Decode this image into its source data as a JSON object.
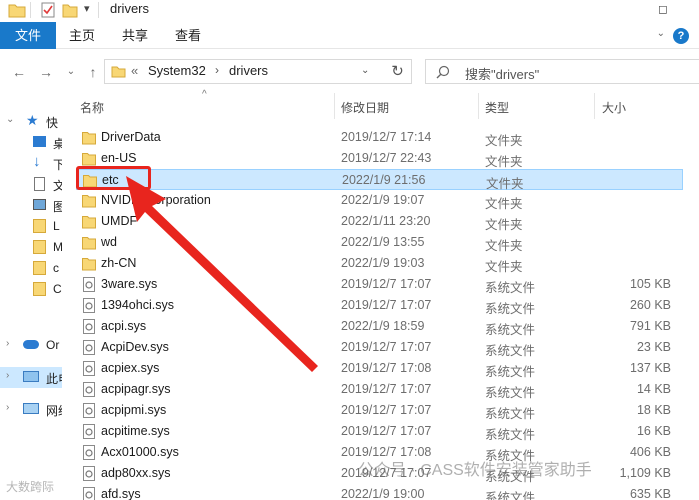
{
  "window": {
    "title": "drivers"
  },
  "ribbon": {
    "tabs": [
      "文件",
      "主页",
      "共享",
      "查看"
    ],
    "help_glyph": "?"
  },
  "address": {
    "overflow": "«",
    "segments": [
      "System32",
      "drivers"
    ]
  },
  "search": {
    "placeholder": "搜索\"drivers\""
  },
  "nav_pane": {
    "items": [
      {
        "label": "快"
      },
      {
        "label": "桌"
      },
      {
        "label": "下"
      },
      {
        "label": "文"
      },
      {
        "label": "图"
      },
      {
        "label": "L"
      },
      {
        "label": "M"
      },
      {
        "label": "c"
      },
      {
        "label": "C"
      },
      {
        "label": "Or"
      },
      {
        "label": "此电"
      },
      {
        "label": "网络"
      }
    ]
  },
  "columns": {
    "name": "名称",
    "date": "修改日期",
    "type": "类型",
    "size": "大小"
  },
  "files": [
    {
      "name": "DriverData",
      "date": "2019/12/7 17:14",
      "type": "文件夹",
      "size": "",
      "kind": "folder"
    },
    {
      "name": "en-US",
      "date": "2019/12/7 22:43",
      "type": "文件夹",
      "size": "",
      "kind": "folder"
    },
    {
      "name": "etc",
      "date": "2022/1/9 21:56",
      "type": "文件夹",
      "size": "",
      "kind": "folder",
      "selected": true
    },
    {
      "name": "NVIDIA Corporation",
      "date": "2022/1/9 19:07",
      "type": "文件夹",
      "size": "",
      "kind": "folder"
    },
    {
      "name": "UMDF",
      "date": "2022/1/11 23:20",
      "type": "文件夹",
      "size": "",
      "kind": "folder"
    },
    {
      "name": "wd",
      "date": "2022/1/9 13:55",
      "type": "文件夹",
      "size": "",
      "kind": "folder"
    },
    {
      "name": "zh-CN",
      "date": "2022/1/9 19:03",
      "type": "文件夹",
      "size": "",
      "kind": "folder"
    },
    {
      "name": "3ware.sys",
      "date": "2019/12/7 17:07",
      "type": "系统文件",
      "size": "105 KB",
      "kind": "sys"
    },
    {
      "name": "1394ohci.sys",
      "date": "2019/12/7 17:07",
      "type": "系统文件",
      "size": "260 KB",
      "kind": "sys"
    },
    {
      "name": "acpi.sys",
      "date": "2022/1/9 18:59",
      "type": "系统文件",
      "size": "791 KB",
      "kind": "sys"
    },
    {
      "name": "AcpiDev.sys",
      "date": "2019/12/7 17:07",
      "type": "系统文件",
      "size": "23 KB",
      "kind": "sys"
    },
    {
      "name": "acpiex.sys",
      "date": "2019/12/7 17:08",
      "type": "系统文件",
      "size": "137 KB",
      "kind": "sys"
    },
    {
      "name": "acpipagr.sys",
      "date": "2019/12/7 17:07",
      "type": "系统文件",
      "size": "14 KB",
      "kind": "sys"
    },
    {
      "name": "acpipmi.sys",
      "date": "2019/12/7 17:07",
      "type": "系统文件",
      "size": "18 KB",
      "kind": "sys"
    },
    {
      "name": "acpitime.sys",
      "date": "2019/12/7 17:07",
      "type": "系统文件",
      "size": "16 KB",
      "kind": "sys"
    },
    {
      "name": "Acx01000.sys",
      "date": "2019/12/7 17:08",
      "type": "系统文件",
      "size": "406 KB",
      "kind": "sys"
    },
    {
      "name": "adp80xx.sys",
      "date": "2019/12/7 17:07",
      "type": "系统文件",
      "size": "1,109 KB",
      "kind": "sys"
    },
    {
      "name": "afd.sys",
      "date": "2022/1/9 19:00",
      "type": "系统文件",
      "size": "635 KB",
      "kind": "sys"
    }
  ],
  "watermark": {
    "text": "公众号 · CASS软件安装管家助手",
    "corner": "大数跨际"
  },
  "colors": {
    "accent": "#1979ca",
    "selection": "#cce8ff",
    "annotation": "#e8251e",
    "folder": "#f8d775"
  }
}
